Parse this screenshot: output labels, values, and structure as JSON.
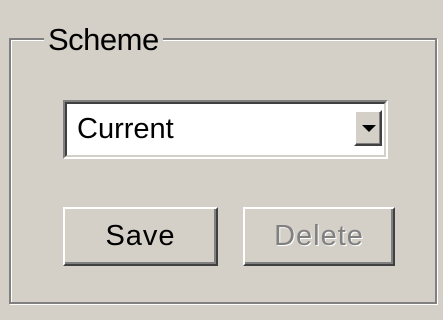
{
  "window": {
    "background_color": "#d4d0c8"
  },
  "scheme_group": {
    "title": "Scheme",
    "combo": {
      "selected_value": "Current",
      "icon": "chevron-down-icon"
    },
    "buttons": {
      "save_label": "Save",
      "delete_label": "Delete",
      "delete_enabled": false
    }
  }
}
